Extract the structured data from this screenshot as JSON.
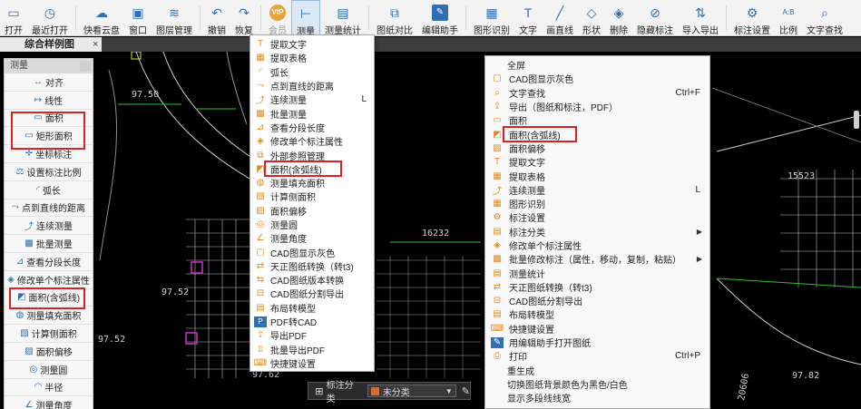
{
  "toolbar": {
    "buttons": [
      {
        "label": "打开",
        "icon": "open-folder-icon"
      },
      {
        "label": "最近打开",
        "icon": "clock-icon"
      },
      {
        "label": "快看云盘",
        "icon": "cloud-icon"
      },
      {
        "label": "窗口",
        "icon": "window-icon"
      },
      {
        "label": "图层管理",
        "icon": "layers-icon"
      },
      {
        "label": "撤销",
        "icon": "undo-icon"
      },
      {
        "label": "恢复",
        "icon": "redo-icon"
      },
      {
        "label": "会员",
        "icon": "vip-icon",
        "badge": "VIP"
      },
      {
        "label": "测量",
        "icon": "measure-icon"
      },
      {
        "label": "测量统计",
        "icon": "measure-stats-icon"
      },
      {
        "label": "图纸对比",
        "icon": "compare-icon"
      },
      {
        "label": "编辑助手",
        "icon": "edit-assistant-icon"
      },
      {
        "label": "图形识别",
        "icon": "shape-recognize-icon"
      },
      {
        "label": "文字",
        "icon": "text-icon"
      },
      {
        "label": "画直线",
        "icon": "line-icon"
      },
      {
        "label": "形状",
        "icon": "shape-icon"
      },
      {
        "label": "删除",
        "icon": "eraser-icon"
      },
      {
        "label": "隐藏标注",
        "icon": "hide-icon"
      },
      {
        "label": "导入导出",
        "icon": "import-export-icon"
      },
      {
        "label": "标注设置",
        "icon": "annotation-settings-icon"
      },
      {
        "label": "比例",
        "icon": "scale-icon",
        "badge": "A:B"
      },
      {
        "label": "文字查找",
        "icon": "text-search-icon"
      }
    ]
  },
  "tab": {
    "title": "综合样例图",
    "close": "×"
  },
  "left_panel": {
    "title": "测量",
    "items": [
      {
        "label": "对齐",
        "icon": "align-icon"
      },
      {
        "label": "线性",
        "icon": "linear-icon"
      },
      {
        "label": "面积",
        "icon": "area-icon"
      },
      {
        "label": "矩形面积",
        "icon": "rect-area-icon"
      },
      {
        "label": "坐标标注",
        "icon": "coordinate-icon"
      },
      {
        "label": "设置标注比例",
        "icon": "set-scale-icon"
      },
      {
        "label": "弧长",
        "icon": "arc-length-icon"
      },
      {
        "label": "点到直线的距离",
        "icon": "point-line-distance-icon"
      },
      {
        "label": "连续测量",
        "icon": "continuous-measure-icon"
      },
      {
        "label": "批量测量",
        "icon": "batch-measure-icon"
      },
      {
        "label": "查看分段长度",
        "icon": "segment-length-icon"
      },
      {
        "label": "修改单个标注属性",
        "icon": "modify-annotation-icon"
      },
      {
        "label": "面积(含弧线)",
        "icon": "area-arc-icon"
      },
      {
        "label": "测量填充面积",
        "icon": "fill-area-icon"
      },
      {
        "label": "计算侧面积",
        "icon": "side-area-icon"
      },
      {
        "label": "面积偏移",
        "icon": "area-offset-icon"
      },
      {
        "label": "测量圆",
        "icon": "circle-measure-icon"
      },
      {
        "label": "半径",
        "icon": "radius-icon"
      },
      {
        "label": "测量角度",
        "icon": "angle-icon"
      }
    ]
  },
  "menu1": {
    "items": [
      {
        "label": "提取文字",
        "icon": "extract-text-icon",
        "shortcut": ""
      },
      {
        "label": "提取表格",
        "icon": "extract-table-icon",
        "shortcut": ""
      },
      {
        "label": "弧长",
        "icon": "arc-length-icon",
        "shortcut": ""
      },
      {
        "label": "点到直线的距离",
        "icon": "point-line-distance-icon",
        "shortcut": ""
      },
      {
        "label": "连续测量",
        "icon": "continuous-measure-icon",
        "shortcut": "L"
      },
      {
        "label": "批量测量",
        "icon": "batch-measure-icon",
        "shortcut": ""
      },
      {
        "label": "查看分段长度",
        "icon": "segment-length-icon",
        "shortcut": ""
      },
      {
        "label": "修改单个标注属性",
        "icon": "modify-annotation-icon",
        "shortcut": ""
      },
      {
        "label": "外部参照管理",
        "icon": "xref-icon",
        "shortcut": ""
      },
      {
        "label": "面积(含弧线)",
        "icon": "area-arc-icon",
        "shortcut": ""
      },
      {
        "label": "测量填充面积",
        "icon": "fill-area-icon",
        "shortcut": ""
      },
      {
        "label": "计算侧面积",
        "icon": "side-area-icon",
        "shortcut": ""
      },
      {
        "label": "面积偏移",
        "icon": "area-offset-icon",
        "shortcut": ""
      },
      {
        "label": "测量圆",
        "icon": "circle-measure-icon",
        "shortcut": ""
      },
      {
        "label": "测量角度",
        "icon": "angle-icon",
        "shortcut": ""
      },
      {
        "label": "CAD图显示灰色",
        "icon": "gray-display-icon",
        "shortcut": ""
      },
      {
        "label": "天正图纸转换（转t3)",
        "icon": "tangent-convert-icon",
        "shortcut": ""
      },
      {
        "label": "CAD图纸版本转换",
        "icon": "version-convert-icon",
        "shortcut": ""
      },
      {
        "label": "CAD图纸分割导出",
        "icon": "split-export-icon",
        "shortcut": ""
      },
      {
        "label": "布局转模型",
        "icon": "layout-to-model-icon",
        "shortcut": ""
      },
      {
        "label": "PDF转CAD",
        "icon": "pdf-to-cad-icon",
        "shortcut": ""
      },
      {
        "label": "导出PDF",
        "icon": "export-pdf-icon",
        "shortcut": ""
      },
      {
        "label": "批量导出PDF",
        "icon": "batch-export-pdf-icon",
        "shortcut": ""
      },
      {
        "label": "快捷键设置",
        "icon": "shortcut-settings-icon",
        "shortcut": ""
      }
    ]
  },
  "menu2": {
    "items": [
      {
        "label": "全屏",
        "icon": "",
        "shortcut": "",
        "submenu": false
      },
      {
        "label": "CAD图显示灰色",
        "icon": "gray-display-icon",
        "shortcut": "",
        "submenu": false
      },
      {
        "label": "文字查找",
        "icon": "text-search-icon",
        "shortcut": "Ctrl+F",
        "submenu": false
      },
      {
        "label": "导出（图纸和标注，PDF）",
        "icon": "export-icon",
        "shortcut": "",
        "submenu": false
      },
      {
        "label": "面积",
        "icon": "area-icon",
        "shortcut": "",
        "submenu": false
      },
      {
        "label": "面积(含弧线)",
        "icon": "area-arc-icon",
        "shortcut": "",
        "submenu": false
      },
      {
        "label": "面积偏移",
        "icon": "area-offset-icon",
        "shortcut": "",
        "submenu": false
      },
      {
        "label": "提取文字",
        "icon": "extract-text-icon",
        "shortcut": "",
        "submenu": false
      },
      {
        "label": "提取表格",
        "icon": "extract-table-icon",
        "shortcut": "",
        "submenu": false
      },
      {
        "label": "连续测量",
        "icon": "continuous-measure-icon",
        "shortcut": "L",
        "submenu": false
      },
      {
        "label": "图形识别",
        "icon": "shape-recognize-icon",
        "shortcut": "",
        "submenu": false
      },
      {
        "label": "标注设置",
        "icon": "annotation-settings-icon",
        "shortcut": "",
        "submenu": false
      },
      {
        "label": "标注分类",
        "icon": "annotation-category-icon",
        "shortcut": "",
        "submenu": true
      },
      {
        "label": "修改单个标注属性",
        "icon": "modify-annotation-icon",
        "shortcut": "",
        "submenu": false
      },
      {
        "label": "批量修改标注（属性，移动，复制，粘贴）",
        "icon": "batch-modify-icon",
        "shortcut": "",
        "submenu": true
      },
      {
        "label": "测量统计",
        "icon": "measure-stats-icon",
        "shortcut": "",
        "submenu": false
      },
      {
        "label": "天正图纸转换（转t3)",
        "icon": "tangent-convert-icon",
        "shortcut": "",
        "submenu": false
      },
      {
        "label": "CAD图纸分割导出",
        "icon": "split-export-icon",
        "shortcut": "",
        "submenu": false
      },
      {
        "label": "布局转模型",
        "icon": "layout-to-model-icon",
        "shortcut": "",
        "submenu": false
      },
      {
        "label": "快捷键设置",
        "icon": "shortcut-settings-icon",
        "shortcut": "",
        "submenu": false
      },
      {
        "label": "用编辑助手打开图纸",
        "icon": "edit-assistant-icon",
        "shortcut": "",
        "submenu": false
      },
      {
        "label": "打印",
        "icon": "print-icon",
        "shortcut": "Ctrl+P",
        "submenu": false
      },
      {
        "label": "重生成",
        "icon": "",
        "shortcut": "",
        "submenu": false
      },
      {
        "label": "切换图纸背景颜色为黑色/白色",
        "icon": "",
        "shortcut": "",
        "submenu": false
      },
      {
        "label": "显示多段线线宽",
        "icon": "",
        "shortcut": "",
        "submenu": false
      }
    ]
  },
  "canvas": {
    "labels": [
      "97.50",
      "97.52",
      "97.52",
      "97.62",
      "16232",
      "15523",
      "20606",
      "97.82"
    ]
  },
  "statusbar": {
    "category_label": "标注分类",
    "selected_value": "未分类",
    "swatch_color": "#e06a1a"
  },
  "colors": {
    "highlight": "#e02020",
    "accent": "#2f6fb2",
    "menu_icon": "#e08a1e"
  }
}
